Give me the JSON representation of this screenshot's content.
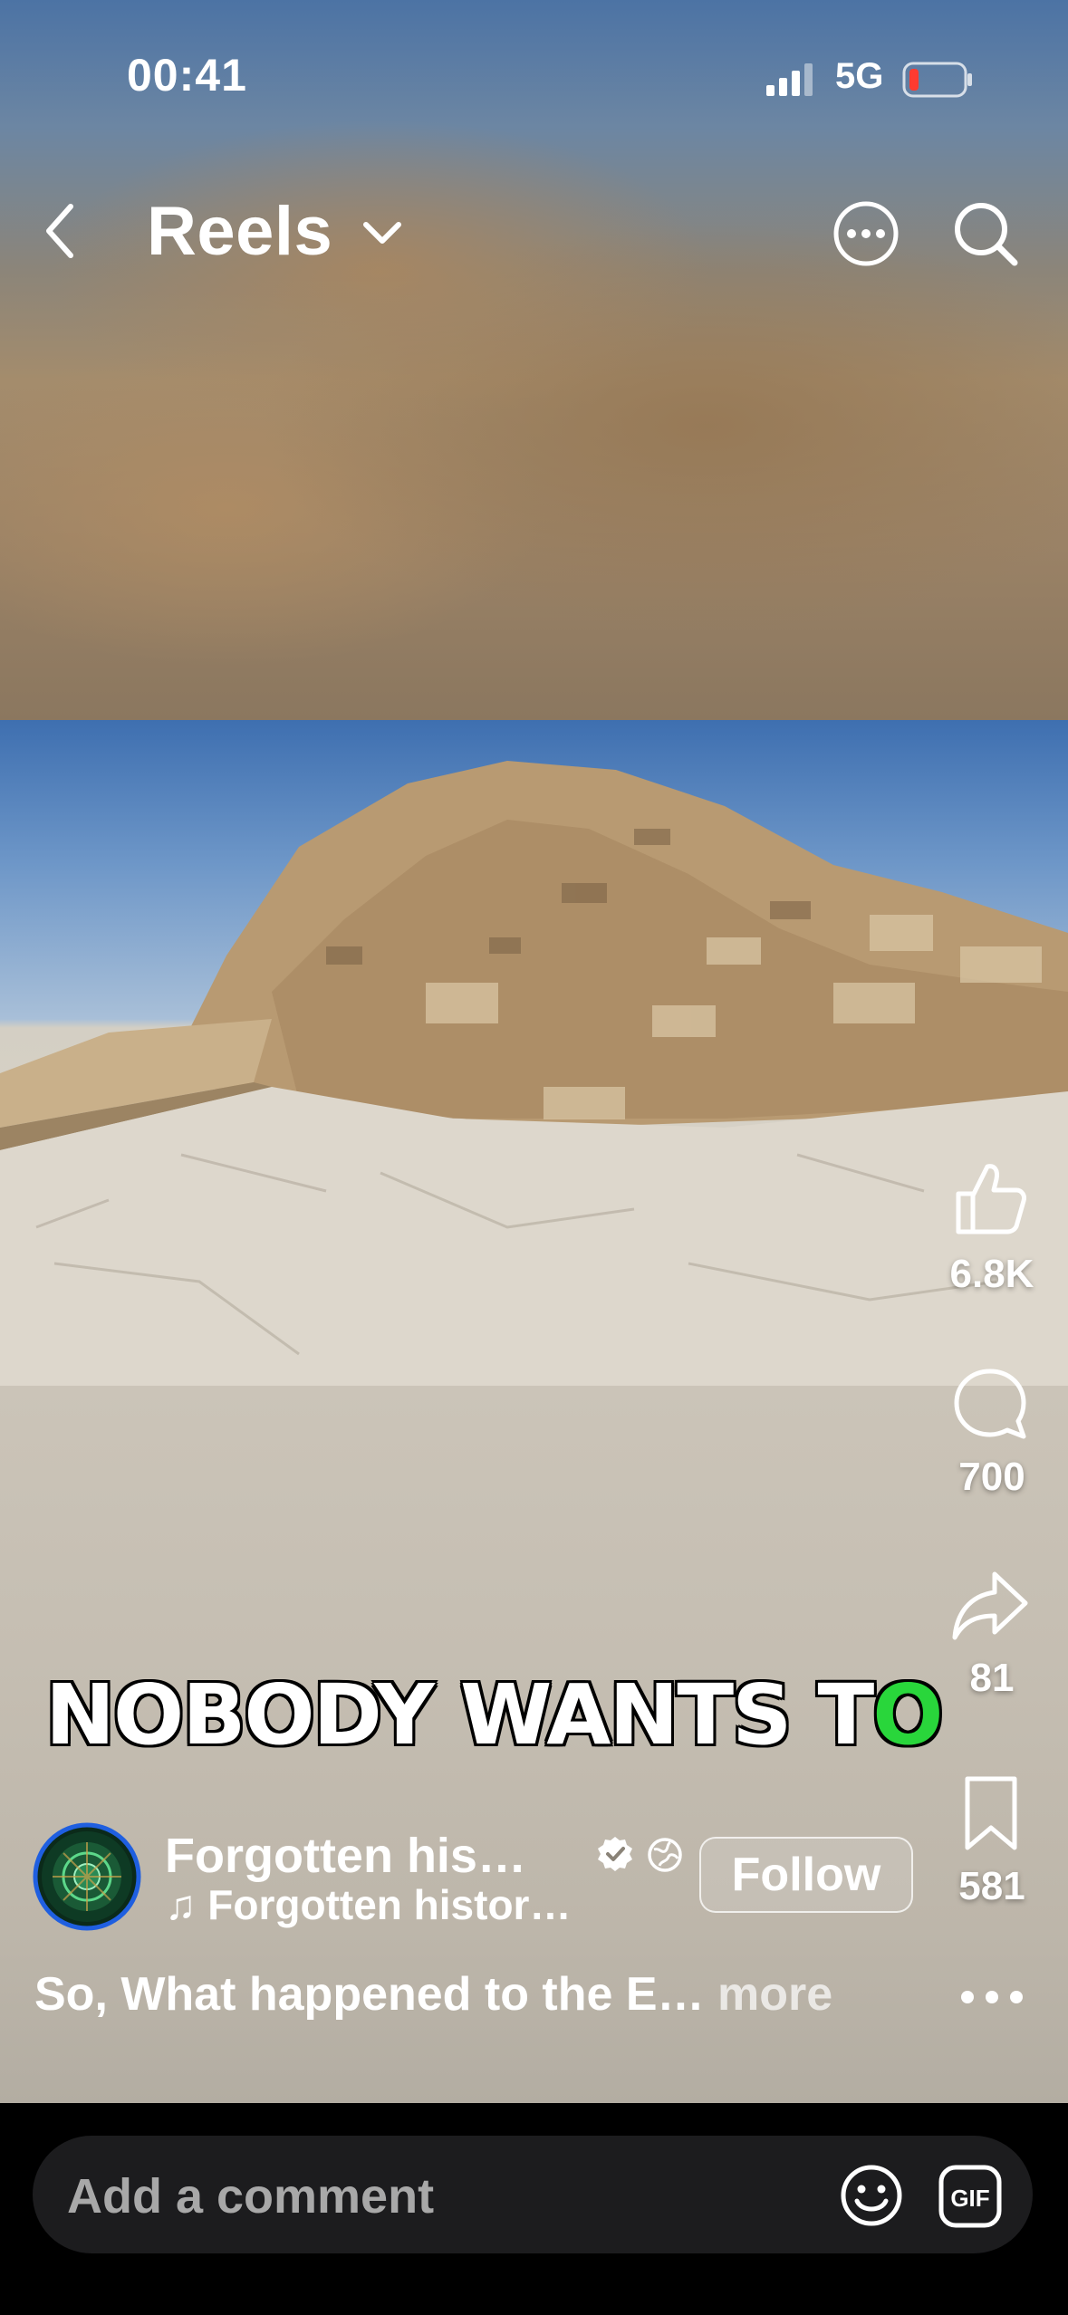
{
  "status_bar": {
    "time": "00:41",
    "network": "5G"
  },
  "header": {
    "title": "Reels"
  },
  "actions": {
    "likes": "6.8K",
    "comments": "700",
    "shares": "81",
    "saves": "581"
  },
  "video": {
    "overlay_text_main": "NOBODY WANTS T",
    "overlay_text_highlight": "O"
  },
  "account": {
    "name": "Forgotten his…",
    "audio": "♫ Forgotten histor…",
    "follow_label": "Follow"
  },
  "caption": {
    "text": "So, What happened to the E…",
    "more_label": " more"
  },
  "comment_bar": {
    "placeholder": "Add a comment",
    "gif_label": "GIF"
  },
  "colors": {
    "highlight": "#29d63b",
    "battery_low": "#ff3b30"
  }
}
